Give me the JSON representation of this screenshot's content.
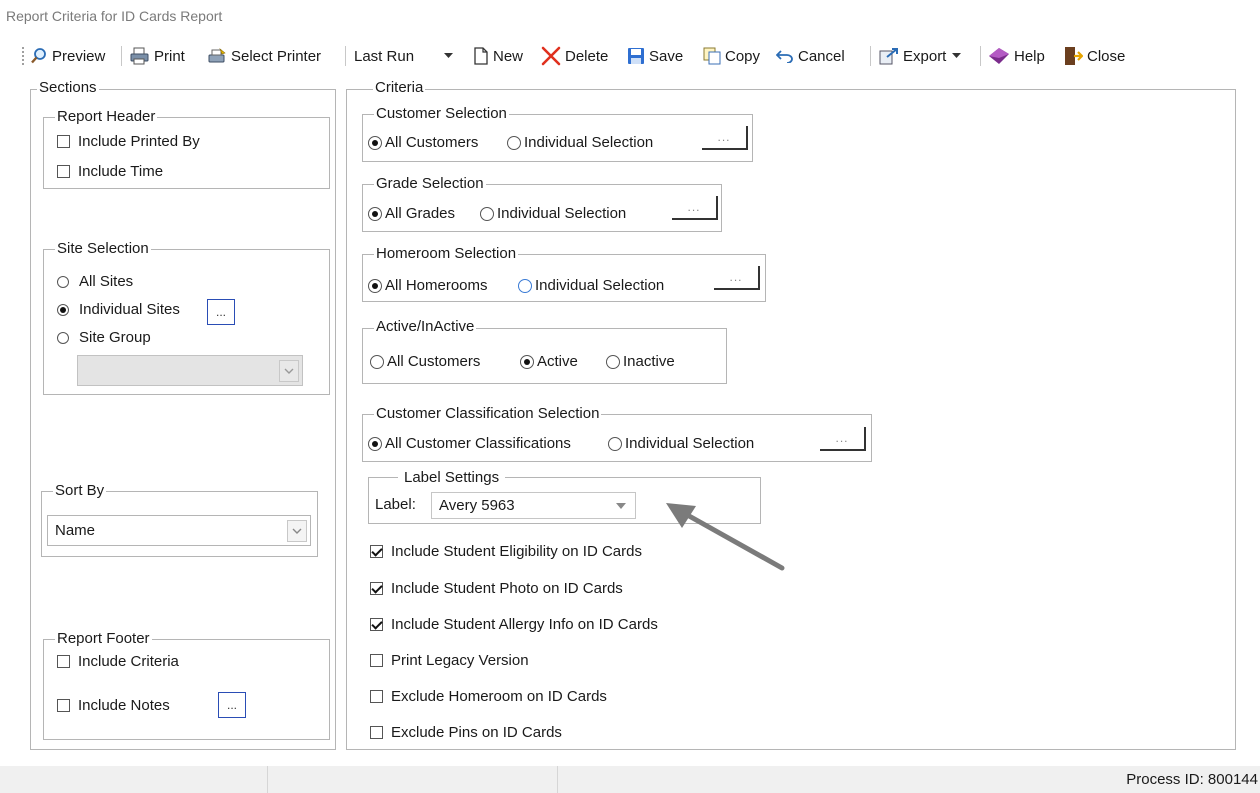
{
  "window": {
    "title": "Report Criteria for ID Cards Report"
  },
  "toolbar": {
    "preview": "Preview",
    "print": "Print",
    "select_printer": "Select Printer",
    "last_run": "Last Run",
    "new": "New",
    "delete": "Delete",
    "save": "Save",
    "copy": "Copy",
    "cancel": "Cancel",
    "export": "Export",
    "help": "Help",
    "close": "Close"
  },
  "sections": {
    "legend": "Sections",
    "report_header": {
      "legend": "Report Header",
      "include_printed_by": {
        "label": "Include Printed By",
        "checked": false
      },
      "include_time": {
        "label": "Include Time",
        "checked": false
      }
    },
    "site_selection": {
      "legend": "Site Selection",
      "all_sites": "All Sites",
      "individual_sites": "Individual Sites",
      "site_group": "Site Group",
      "selected": "individual_sites",
      "ellipsis": "..."
    },
    "sort_by": {
      "legend": "Sort By",
      "value": "Name"
    },
    "report_footer": {
      "legend": "Report Footer",
      "include_criteria": {
        "label": "Include Criteria",
        "checked": false
      },
      "include_notes": {
        "label": "Include Notes",
        "checked": false
      },
      "ellipsis": "..."
    }
  },
  "criteria": {
    "legend": "Criteria",
    "customer_selection": {
      "legend": "Customer Selection",
      "opt_all": "All Customers",
      "opt_individual": "Individual Selection",
      "ellipsis": "..."
    },
    "grade_selection": {
      "legend": "Grade Selection",
      "opt_all": "All Grades",
      "opt_individual": "Individual Selection",
      "ellipsis": "..."
    },
    "homeroom_selection": {
      "legend": "Homeroom Selection",
      "opt_all": "All Homerooms",
      "opt_individual": "Individual Selection",
      "ellipsis": "..."
    },
    "active_inactive": {
      "legend": "Active/InActive",
      "opt_all": "All Customers",
      "opt_active": "Active",
      "opt_inactive": "Inactive"
    },
    "classification_selection": {
      "legend": "Customer Classification Selection",
      "opt_all": "All Customer Classifications",
      "opt_individual": "Individual Selection",
      "ellipsis": "..."
    },
    "label_settings": {
      "legend": "Label Settings",
      "label": "Label:",
      "value": "Avery 5963"
    },
    "checkboxes": [
      {
        "label": "Include Student Eligibility on ID Cards",
        "checked": true
      },
      {
        "label": "Include Student Photo on ID Cards",
        "checked": true
      },
      {
        "label": "Include Student Allergy Info on ID Cards",
        "checked": true
      },
      {
        "label": "Print Legacy Version",
        "checked": false
      },
      {
        "label": "Exclude Homeroom on ID Cards",
        "checked": false
      },
      {
        "label": "Exclude Pins on ID Cards",
        "checked": false
      }
    ]
  },
  "status_bar": {
    "process_id": "Process ID: 800144"
  }
}
